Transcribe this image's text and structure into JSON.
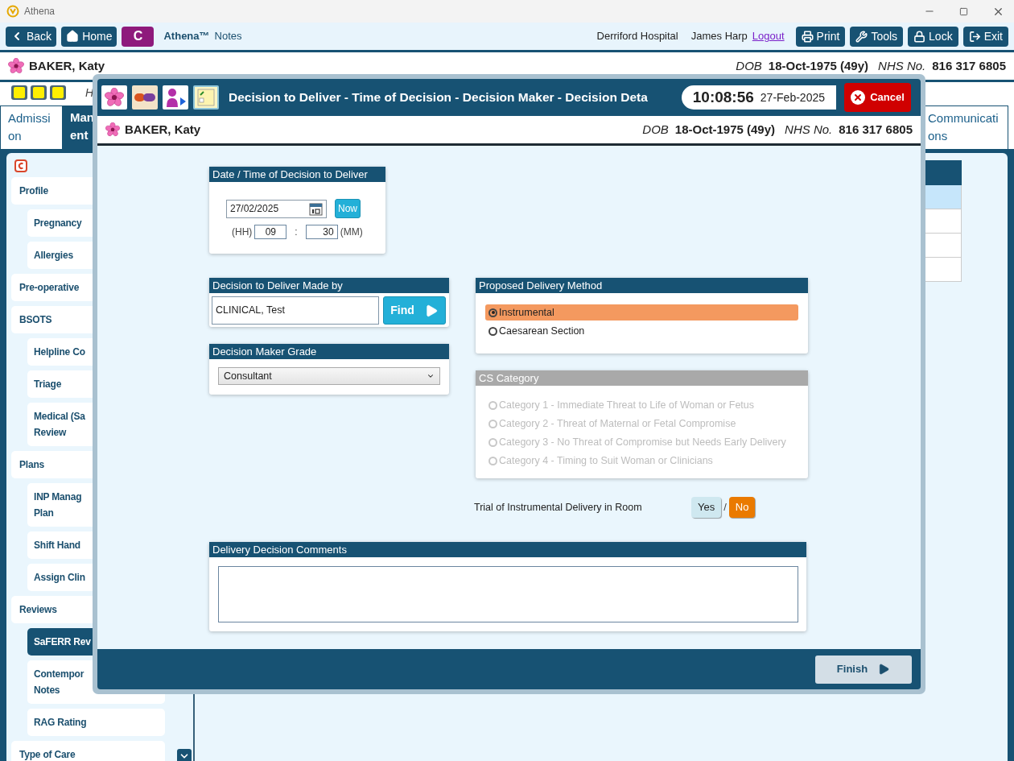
{
  "window": {
    "title": "Athena"
  },
  "toolbar": {
    "left_buttons": [
      "Back",
      "Home"
    ],
    "c_button": "C",
    "app_name": "Athena™",
    "app_section": "Notes",
    "hospital": "Derriford Hospital",
    "user": "James Harp",
    "logout": "Logout",
    "right_buttons": [
      "Print",
      "Tools",
      "Lock",
      "Exit"
    ]
  },
  "patient": {
    "name": "BAKER, Katy",
    "dob_label": "DOB",
    "dob": "18-Oct-1975 (49y)",
    "nhs_label": "NHS No.",
    "nhs": "816 317 6805"
  },
  "info_row": {
    "text": "H"
  },
  "table": {
    "rows": [
      {
        "selected": true
      },
      {
        "selected": false
      },
      {
        "selected": false
      },
      {
        "selected": false
      }
    ]
  },
  "tabs": [
    {
      "label": "Admissi\non",
      "selected": false
    },
    {
      "label": "Man\nent",
      "selected": true
    },
    {
      "label": "Communicati\nons",
      "selected": false
    }
  ],
  "sidebar": {
    "items": [
      {
        "label": "Profile",
        "selected": false,
        "children": [
          {
            "label": "Pregnancy",
            "selected": false
          },
          {
            "label": "Allergies",
            "selected": false
          }
        ]
      },
      {
        "label": "Pre-operative",
        "selected": false
      },
      {
        "label": "BSOTS",
        "selected": false,
        "children": [
          {
            "label": "Helpline Co",
            "selected": false
          },
          {
            "label": "Triage",
            "selected": false
          },
          {
            "label": "Medical (Sa\nReview",
            "selected": false
          }
        ]
      },
      {
        "label": "Plans",
        "selected": false,
        "children": [
          {
            "label": "INP Manag\nPlan",
            "selected": false
          },
          {
            "label": "Shift Hand",
            "selected": false
          },
          {
            "label": "Assign Clin",
            "selected": false
          }
        ]
      },
      {
        "label": "Reviews",
        "selected": false,
        "children": [
          {
            "label": "SaFERR Rev",
            "selected": true
          },
          {
            "label": "Contempor\nNotes",
            "selected": false
          },
          {
            "label": "RAG Rating",
            "selected": false
          }
        ]
      },
      {
        "label": "Type of Care",
        "selected": false
      }
    ]
  },
  "dialog": {
    "title": "Decision to Deliver - Time of Decision - Decision Maker - Decision Deta",
    "time": "10:08:56",
    "date": "27-Feb-2025",
    "cancel": "Cancel",
    "patient": {
      "name": "BAKER, Katy",
      "dob_label": "DOB",
      "dob": "18-Oct-1975 (49y)",
      "nhs_label": "NHS No.",
      "nhs": "816 317 6805"
    },
    "date_panel": {
      "title": "Date / Time of Decision to Deliver",
      "date": "27/02/2025",
      "now": "Now",
      "hh_label": "(HH)",
      "hh": "09",
      "separator": ":",
      "mm": "30",
      "mm_label": "(MM)"
    },
    "made_by": {
      "title": "Decision to Deliver Made by",
      "value": "CLINICAL, Test",
      "find": "Find"
    },
    "grade": {
      "title": "Decision Maker Grade",
      "value": "Consultant"
    },
    "delivery_method": {
      "title": "Proposed Delivery Method",
      "options": [
        {
          "label": "Instrumental",
          "selected": true
        },
        {
          "label": "Caesarean Section",
          "selected": false
        }
      ]
    },
    "cs_category": {
      "title": "CS Category",
      "disabled": true,
      "options": [
        {
          "label": "Category 1 - Immediate Threat to Life of Woman or Fetus",
          "selected": false
        },
        {
          "label": "Category 2 - Threat of Maternal or Fetal Compromise",
          "selected": false
        },
        {
          "label": "Category 3 - No Threat of Compromise but Needs Early Delivery",
          "selected": false
        },
        {
          "label": "Category 4 - Timing to Suit Woman or Clinicians",
          "selected": false
        }
      ]
    },
    "trial": {
      "label": "Trial of Instrumental Delivery in Room",
      "separator": "/",
      "options": [
        {
          "label": "Yes",
          "selected": false
        },
        {
          "label": "No",
          "selected": true
        }
      ]
    },
    "comments": {
      "title": "Delivery Decision Comments"
    },
    "finish": "Finish"
  }
}
